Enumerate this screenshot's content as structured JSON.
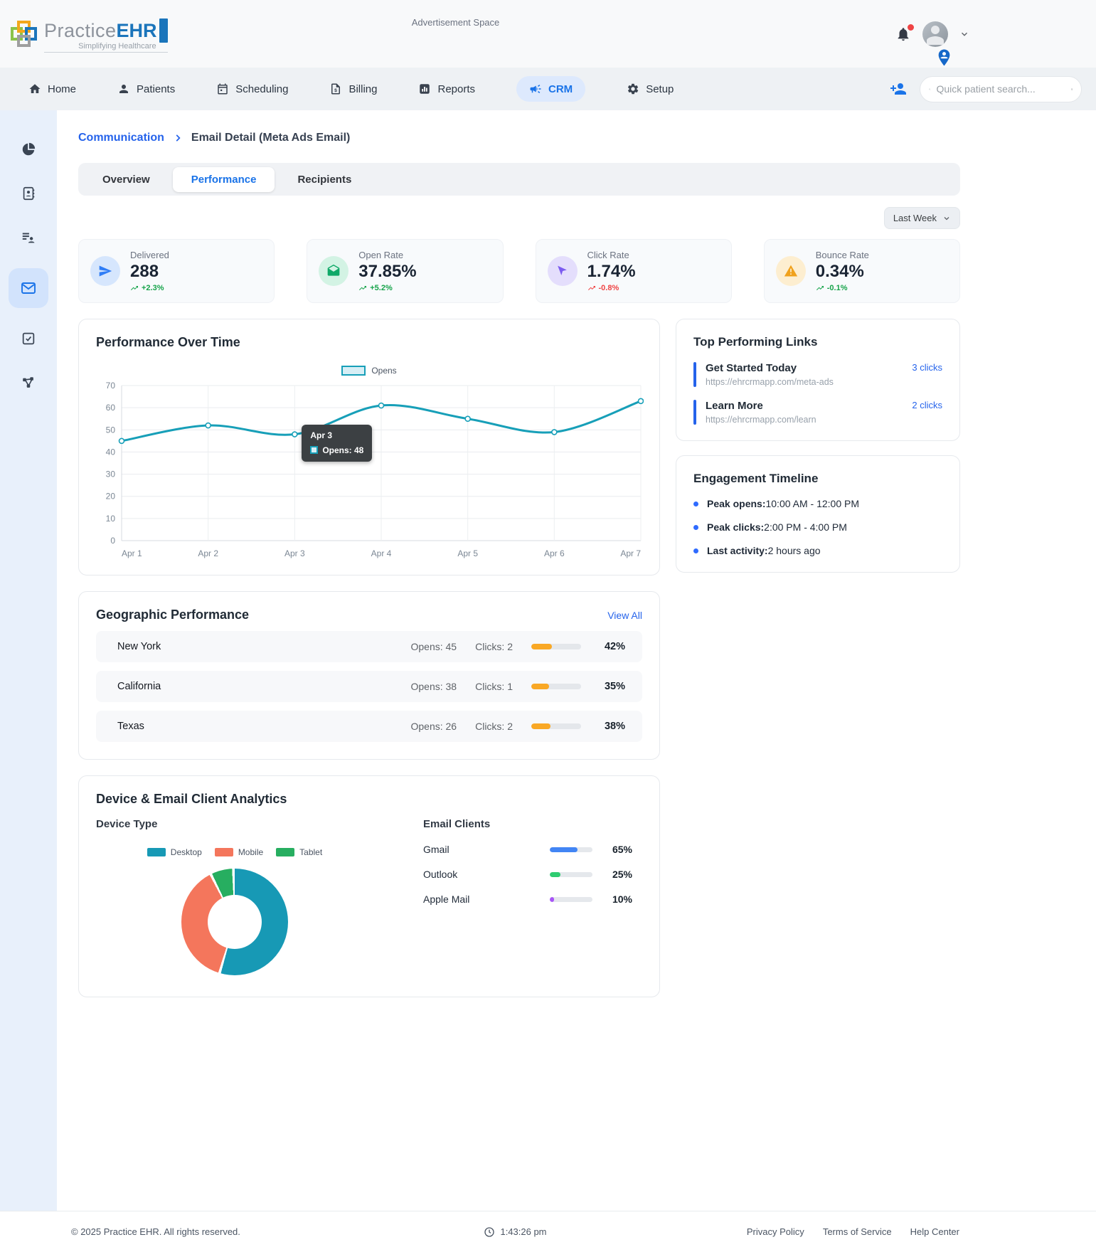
{
  "header": {
    "ad_text": "Advertisement Space",
    "logo": {
      "name_a": "Practice",
      "name_b": "EHR",
      "tagline": "Simplifying Healthcare"
    }
  },
  "nav": {
    "items": [
      {
        "label": "Home",
        "icon": "home-icon",
        "active": false
      },
      {
        "label": "Patients",
        "icon": "patients-icon",
        "active": false
      },
      {
        "label": "Scheduling",
        "icon": "calendar-icon",
        "active": false
      },
      {
        "label": "Billing",
        "icon": "billing-icon",
        "active": false
      },
      {
        "label": "Reports",
        "icon": "reports-icon",
        "active": false
      },
      {
        "label": "CRM",
        "icon": "megaphone-icon",
        "active": true
      },
      {
        "label": "Setup",
        "icon": "gear-icon",
        "active": false
      }
    ],
    "search_placeholder": "Quick patient search..."
  },
  "sidebar": {
    "items": [
      {
        "icon": "pie-chart-icon",
        "active": false
      },
      {
        "icon": "contacts-icon",
        "active": false
      },
      {
        "icon": "leads-icon",
        "active": false
      },
      {
        "icon": "email-icon",
        "active": true
      },
      {
        "icon": "tasks-icon",
        "active": false
      },
      {
        "icon": "automation-icon",
        "active": false
      }
    ]
  },
  "breadcrumb": {
    "parent": "Communication",
    "current": "Email Detail (Meta Ads Email)"
  },
  "tabs": {
    "items": [
      {
        "label": "Overview",
        "active": false
      },
      {
        "label": "Performance",
        "active": true
      },
      {
        "label": "Recipients",
        "active": false
      }
    ]
  },
  "period_filter": {
    "label": "Last Week"
  },
  "stats": [
    {
      "label": "Delivered",
      "value": "288",
      "trend": "+2.3%",
      "direction": "up",
      "icon": "send-icon",
      "icon_color": "#2f7df6",
      "icon_bg": "#d6e6fd"
    },
    {
      "label": "Open Rate",
      "value": "37.85%",
      "trend": "+5.2%",
      "direction": "up",
      "icon": "open-envelope-icon",
      "icon_color": "#0fa968",
      "icon_bg": "#d3f3e4"
    },
    {
      "label": "Click Rate",
      "value": "1.74%",
      "trend": "-0.8%",
      "direction": "down",
      "icon": "cursor-icon",
      "icon_color": "#7c5cf0",
      "icon_bg": "#e4defc"
    },
    {
      "label": "Bounce Rate",
      "value": "0.34%",
      "trend": "-0.1%",
      "direction": "up",
      "icon": "warning-icon",
      "icon_color": "#f0a11c",
      "icon_bg": "#fdeed0"
    }
  ],
  "chart_data": [
    {
      "type": "line",
      "title": "Performance Over Time",
      "categories": [
        "Apr 1",
        "Apr 2",
        "Apr 3",
        "Apr 4",
        "Apr 5",
        "Apr 6",
        "Apr 7"
      ],
      "series": [
        {
          "name": "Opens",
          "values": [
            45,
            52,
            48,
            61,
            55,
            49,
            63
          ]
        }
      ],
      "ylim": [
        0,
        70
      ],
      "ytick_step": 10,
      "grid": true,
      "legend_position": "top-center",
      "line_color": "#179fb8",
      "tooltip": {
        "index": 2,
        "title": "Apr 3",
        "label": "Opens: 48"
      }
    },
    {
      "type": "pie",
      "title": "Device Type",
      "donut": true,
      "labels": [
        "Desktop",
        "Mobile",
        "Tablet"
      ],
      "values": [
        55,
        38,
        7
      ],
      "colors": [
        "#1799b5",
        "#f4765c",
        "#27ae60"
      ]
    },
    {
      "type": "bar",
      "title": "Email Clients",
      "categories": [
        "Gmail",
        "Outlook",
        "Apple Mail"
      ],
      "values": [
        65,
        25,
        10
      ],
      "unit": "%",
      "colors": [
        "#4285f4",
        "#2ecc71",
        "#a855f7"
      ]
    }
  ],
  "top_links": {
    "title": "Top Performing Links",
    "items": [
      {
        "title": "Get Started Today",
        "url": "https://ehrcrmapp.com/meta-ads",
        "clicks": "3 clicks"
      },
      {
        "title": "Learn More",
        "url": "https://ehrcrmapp.com/learn",
        "clicks": "2 clicks"
      }
    ]
  },
  "engagement": {
    "title": "Engagement Timeline",
    "items": [
      {
        "label": "Peak opens:",
        "value": "10:00 AM - 12:00 PM"
      },
      {
        "label": "Peak clicks:",
        "value": "2:00 PM - 4:00 PM"
      },
      {
        "label": "Last activity:",
        "value": "2 hours ago"
      }
    ]
  },
  "geo": {
    "title": "Geographic Performance",
    "view_all": "View All",
    "rows": [
      {
        "region": "New York",
        "opens": "Opens: 45",
        "clicks": "Clicks: 2",
        "percent": 42,
        "percent_label": "42%"
      },
      {
        "region": "California",
        "opens": "Opens: 38",
        "clicks": "Clicks: 1",
        "percent": 35,
        "percent_label": "35%"
      },
      {
        "region": "Texas",
        "opens": "Opens: 26",
        "clicks": "Clicks: 2",
        "percent": 38,
        "percent_label": "38%"
      }
    ]
  },
  "device_panel": {
    "title": "Device & Email Client Analytics",
    "device_title": "Device Type",
    "email_title": "Email Clients",
    "email_rows": [
      {
        "label": "Gmail",
        "percent": 65,
        "percent_label": "65%"
      },
      {
        "label": "Outlook",
        "percent": 25,
        "percent_label": "25%"
      },
      {
        "label": "Apple Mail",
        "percent": 10,
        "percent_label": "10%"
      }
    ]
  },
  "footer": {
    "copyright": "© 2025 Practice EHR. All rights reserved.",
    "time": "1:43:26 pm",
    "links": [
      "Privacy Policy",
      "Terms of Service",
      "Help Center"
    ]
  }
}
